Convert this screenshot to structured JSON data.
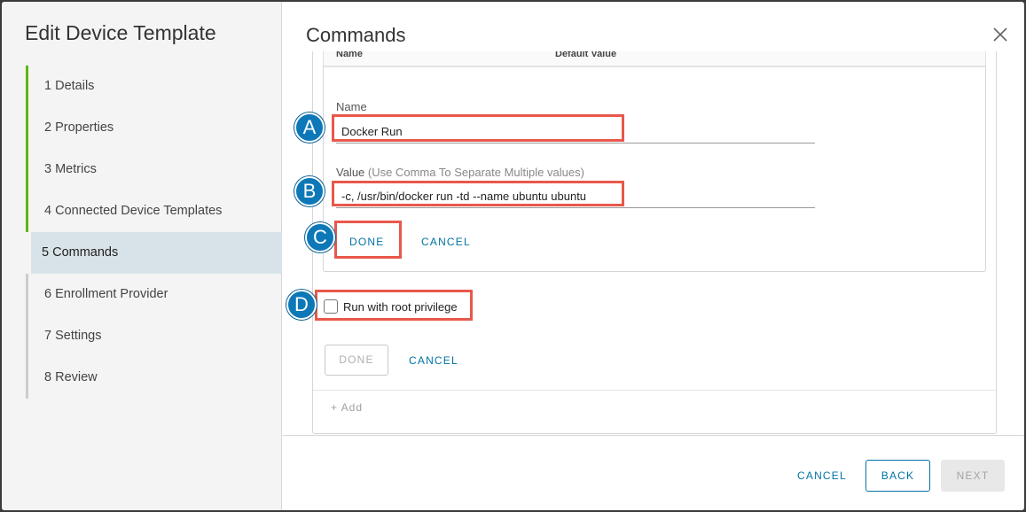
{
  "wizard": {
    "title": "Edit Device Template",
    "steps": [
      {
        "label": "1 Details",
        "state": "done"
      },
      {
        "label": "2 Properties",
        "state": "done"
      },
      {
        "label": "3 Metrics",
        "state": "done"
      },
      {
        "label": "4 Connected Device Templates",
        "state": "done"
      },
      {
        "label": "5 Commands",
        "state": "active"
      },
      {
        "label": "6 Enrollment Provider",
        "state": "pending"
      },
      {
        "label": "7 Settings",
        "state": "pending"
      },
      {
        "label": "8 Review",
        "state": "pending"
      }
    ]
  },
  "content": {
    "title": "Commands",
    "close_icon": "close-icon",
    "grid": {
      "col_name": "Name",
      "col_default_value": "Default Value"
    },
    "form": {
      "name_label": "Name",
      "name_value": "Docker Run",
      "value_label": "Value",
      "value_hint": "(Use Comma To Separate Multiple values)",
      "value_value": "-c, /usr/bin/docker run -td --name ubuntu ubuntu",
      "done_label": "DONE",
      "cancel_label": "CANCEL"
    },
    "root_privilege": {
      "label": "Run with root privilege",
      "checked": false
    },
    "outer_actions": {
      "done_label": "DONE",
      "cancel_label": "CANCEL"
    },
    "add_label": "+ Add"
  },
  "callouts": {
    "a": "A",
    "b": "B",
    "c": "C",
    "d": "D"
  },
  "footer": {
    "cancel_label": "CANCEL",
    "back_label": "BACK",
    "next_label": "NEXT"
  },
  "colors": {
    "accent": "#0072a3",
    "highlight": "#e8584a",
    "badge": "#0d78b8",
    "step_done": "#60b515"
  }
}
